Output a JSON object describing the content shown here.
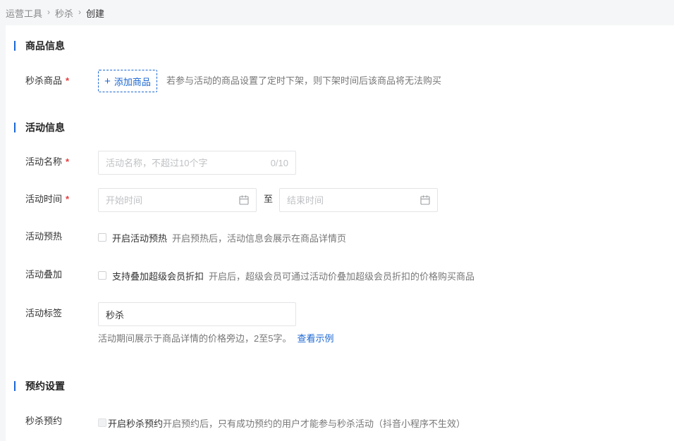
{
  "breadcrumb": {
    "items": [
      "运营工具",
      "秒杀",
      "创建"
    ],
    "separator": "›"
  },
  "sections": {
    "product": {
      "title": "商品信息"
    },
    "activity": {
      "title": "活动信息"
    },
    "reservation": {
      "title": "预约设置"
    }
  },
  "product": {
    "label": "秒杀商品",
    "required_mark": "*",
    "add_button": "添加商品",
    "add_icon": "+",
    "hint": "若参与活动的商品设置了定时下架，则下架时间后该商品将无法购买"
  },
  "activity": {
    "name": {
      "label": "活动名称",
      "required_mark": "*",
      "value": "",
      "placeholder": "活动名称，不超过10个字",
      "counter": "0/10"
    },
    "time": {
      "label": "活动时间",
      "required_mark": "*",
      "start_placeholder": "开始时间",
      "to": "至",
      "end_placeholder": "结束时间"
    },
    "preheat": {
      "label": "活动预热",
      "checkbox_label": "开启活动预热",
      "checked": false,
      "hint": "开启预热后，活动信息会展示在商品详情页"
    },
    "stack": {
      "label": "活动叠加",
      "checkbox_label": "支持叠加超级会员折扣",
      "checked": false,
      "hint": "开启后，超级会员可通过活动价叠加超级会员折扣的价格购买商品"
    },
    "tag": {
      "label": "活动标签",
      "value": "秒杀",
      "hint": "活动期间展示于商品详情的价格旁边，2至5字。",
      "link": "查看示例"
    }
  },
  "reservation": {
    "label": "秒杀预约",
    "checkbox_label": "开启秒杀预约",
    "checked": false,
    "disabled": true,
    "hint": "开启预约后，只有成功预约的用户才能参与秒杀活动（抖音小程序不生效）"
  },
  "colors": {
    "accent": "#1966d2",
    "required": "#e43b3b",
    "page_background": "#f5f6f8"
  },
  "icons": {
    "calendar": "calendar-icon",
    "breadcrumb_separator": "chevron-right-icon",
    "add": "plus-icon"
  }
}
